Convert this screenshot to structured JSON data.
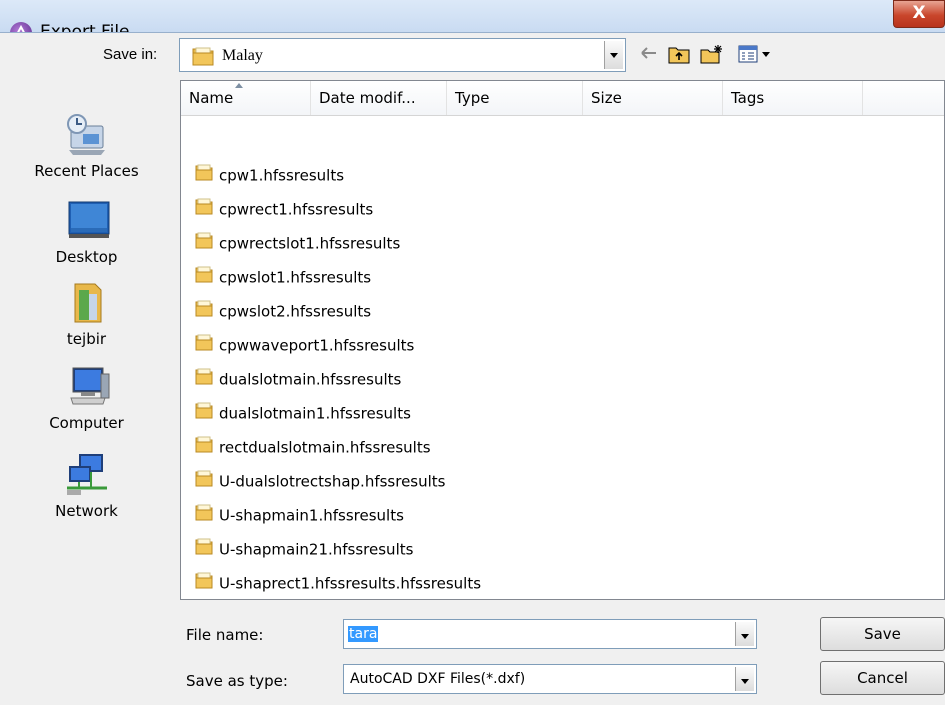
{
  "window": {
    "title": "Export File",
    "close_glyph": "X"
  },
  "toolbar": {
    "save_in_label": "Save in:",
    "save_in_value": "Malay",
    "icons": [
      "back-arrow-icon",
      "up-folder-icon",
      "new-folder-icon",
      "view-menu-icon"
    ]
  },
  "places": [
    {
      "label": "Recent Places",
      "icon": "recent-places-icon"
    },
    {
      "label": "Desktop",
      "icon": "desktop-icon"
    },
    {
      "label": "tejbir",
      "icon": "user-folder-icon"
    },
    {
      "label": "Computer",
      "icon": "computer-icon"
    },
    {
      "label": "Network",
      "icon": "network-icon"
    }
  ],
  "columns": [
    "Name",
    "Date modif...",
    "Type",
    "Size",
    "Tags"
  ],
  "files": [
    "cpw1.hfssresults",
    "cpwrect1.hfssresults",
    "cpwrectslot1.hfssresults",
    "cpwslot1.hfssresults",
    "cpwslot2.hfssresults",
    "cpwwaveport1.hfssresults",
    "dualslotmain.hfssresults",
    "dualslotmain1.hfssresults",
    "rectdualslotmain.hfssresults",
    "U-dualslotrectshap.hfssresults",
    "U-shapmain1.hfssresults",
    "U-shapmain21.hfssresults",
    "U-shaprect1.hfssresults.hfssresults"
  ],
  "form": {
    "file_name_label": "File name:",
    "file_name_value": "tara",
    "save_as_type_label": "Save as type:",
    "save_as_type_value": "AutoCAD DXF Files(*.dxf)",
    "save_button": "Save",
    "cancel_button": "Cancel"
  },
  "colors": {
    "title_bar": "#c6d9f1",
    "folder": "#e8b84a",
    "selection": "#3399ff",
    "close_button": "#c9462c"
  }
}
